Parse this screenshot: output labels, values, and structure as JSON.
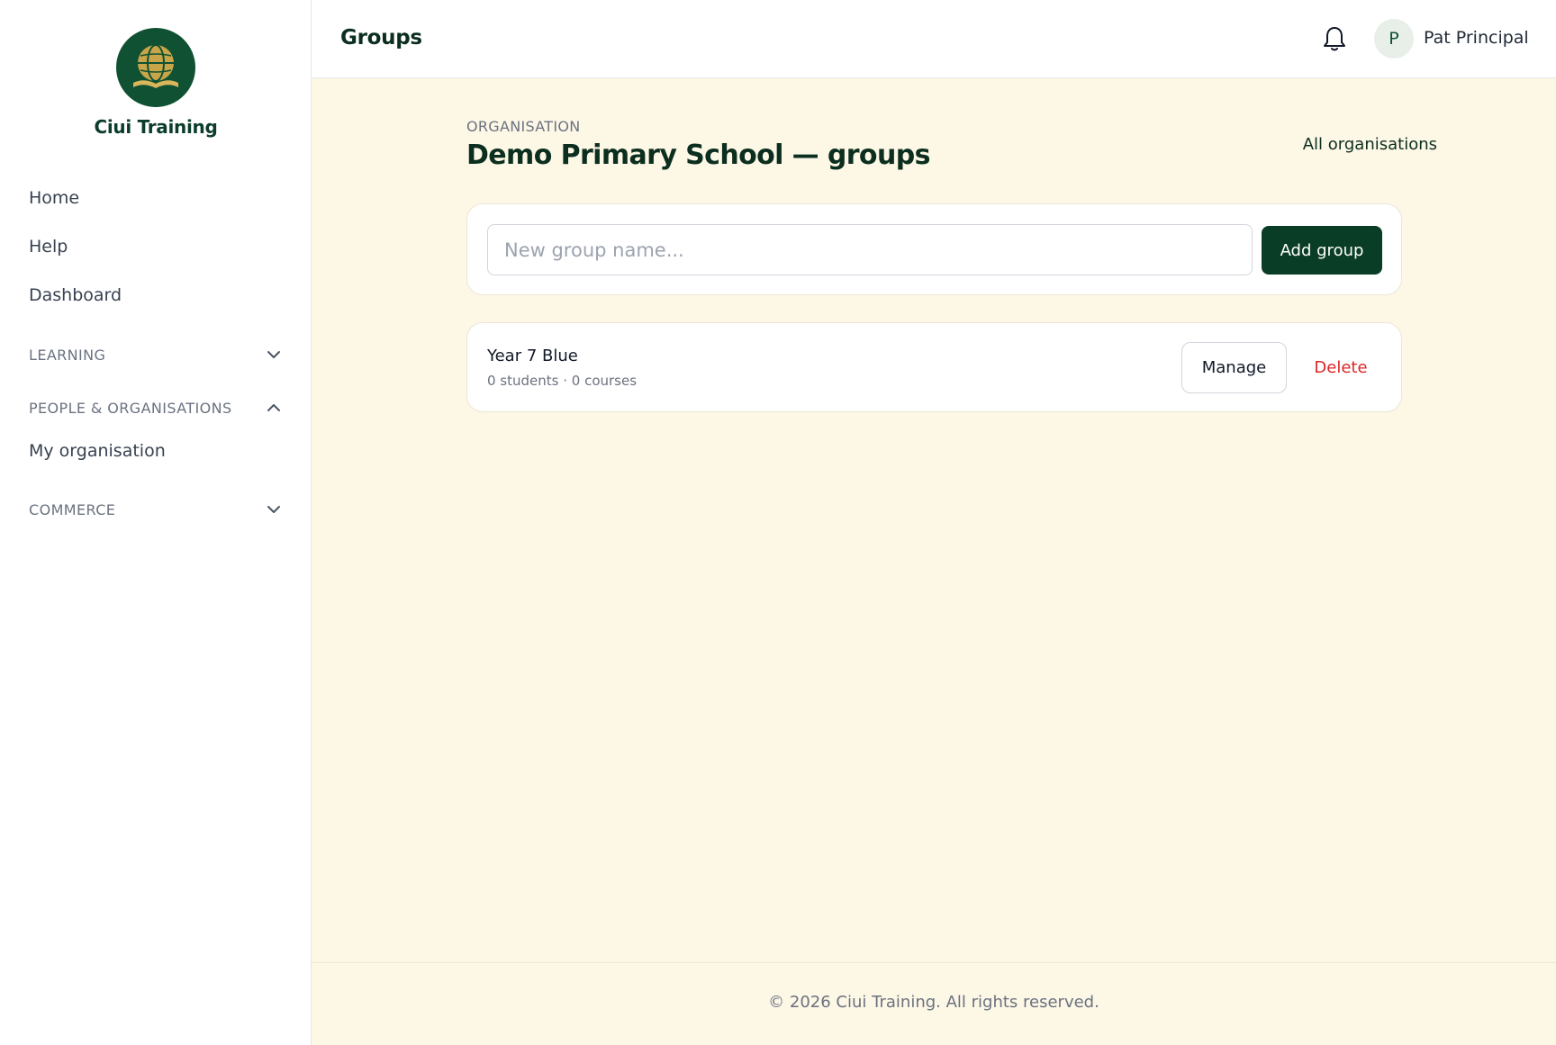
{
  "brand": {
    "name": "Ciui Training",
    "logo_icon": "globe-book-icon",
    "logo_color": "#0f5132"
  },
  "sidebar": {
    "items": [
      {
        "label": "Home"
      },
      {
        "label": "Help"
      },
      {
        "label": "Dashboard"
      }
    ],
    "sections": [
      {
        "label": "LEARNING",
        "expanded": false,
        "items": []
      },
      {
        "label": "PEOPLE & ORGANISATIONS",
        "expanded": true,
        "items": [
          {
            "label": "My organisation"
          }
        ]
      },
      {
        "label": "COMMERCE",
        "expanded": false,
        "items": []
      }
    ]
  },
  "header": {
    "title": "Groups",
    "notification_icon": "bell-icon",
    "user": {
      "initial": "P",
      "name": "Pat Principal"
    }
  },
  "page": {
    "eyebrow": "ORGANISATION",
    "title": "Demo Primary School — groups",
    "all_orgs_link": "All organisations"
  },
  "add_group": {
    "placeholder": "New group name...",
    "value": "",
    "button_label": "Add group"
  },
  "groups": [
    {
      "name": "Year 7 Blue",
      "meta": "0 students · 0 courses",
      "manage_label": "Manage",
      "delete_label": "Delete"
    }
  ],
  "footer": {
    "text": "© 2026 Ciui Training. All rights reserved."
  },
  "colors": {
    "brand_dark": "#0a3d26",
    "page_bg": "#fdf7e6",
    "danger": "#dc2626"
  }
}
